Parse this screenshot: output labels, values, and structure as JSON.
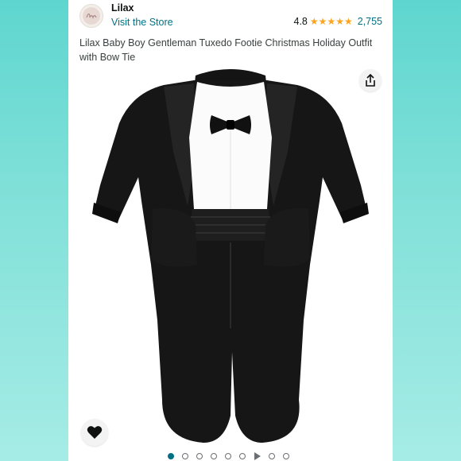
{
  "store": {
    "brand": "Lilax",
    "visit_label": "Visit the Store",
    "logo_icon": "lilax-logo-icon"
  },
  "rating": {
    "value": "4.8",
    "stars": 5,
    "count": "2,755"
  },
  "product": {
    "title": "Lilax Baby Boy Gentleman Tuxedo Footie Christmas Holiday Outfit with Bow Tie",
    "image_icon": "tuxedo-footie-image"
  },
  "actions": {
    "share_icon": "share-icon",
    "wishlist_icon": "heart-icon"
  },
  "carousel": {
    "total_dots": 9,
    "active_index": 0,
    "video_index": 5
  },
  "colors": {
    "link": "#007185",
    "star": "#ffa41c",
    "background": "#7fe0d8"
  }
}
